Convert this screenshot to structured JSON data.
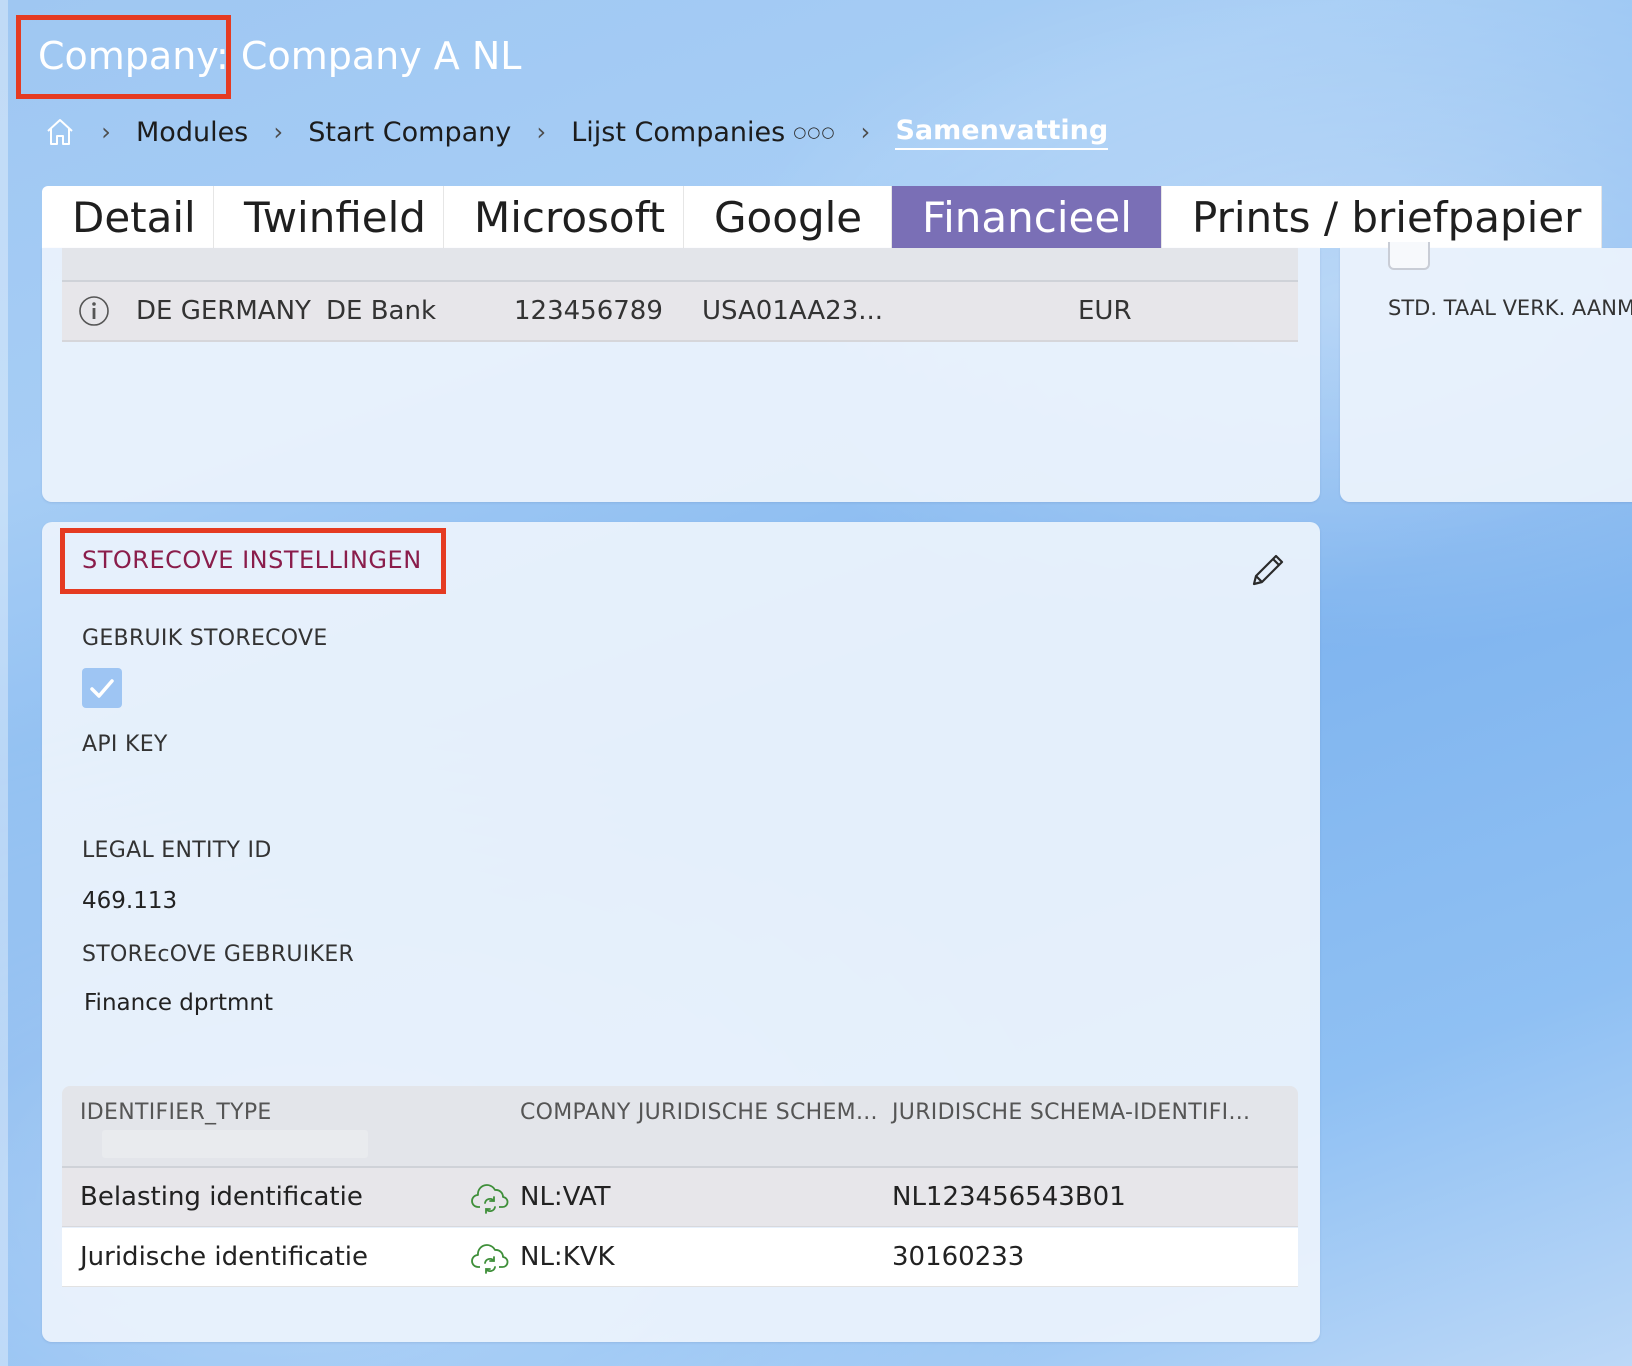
{
  "header": {
    "title_prefix": "Company:",
    "title_name": " Company A NL"
  },
  "breadcrumb": {
    "home_icon": "home-icon",
    "items": [
      "Modules",
      "Start Company",
      "Lijst Companies",
      "Samenvatting"
    ],
    "more_icon": "ellipsis-icon"
  },
  "tabs": [
    "Detail",
    "Twinfield",
    "Microsoft",
    "Google",
    "Financieel",
    "Prints / briefpapier"
  ],
  "active_tab": "Financieel",
  "bank_table": {
    "rows": [
      {
        "country": "DE GERMANY",
        "bank": "DE Bank",
        "number": "123456789",
        "iban": "USA01AA23...",
        "currency": "EUR"
      }
    ]
  },
  "right_panel": {
    "label": "STD. TAAL VERK. AANM"
  },
  "storecove": {
    "title": "STORECOVE INSTELLINGEN",
    "gebruik_label": "GEBRUIK STORECOVE",
    "gebruik_checked": true,
    "api_key_label": "API KEY",
    "api_key_value": "",
    "legal_entity_label": "LEGAL ENTITY ID",
    "legal_entity_value": "469.113",
    "gebruiker_label": "STOREcOVE GEBRUIKER",
    "gebruiker_value": "Finance dprtmnt"
  },
  "identifier_table": {
    "columns": [
      "IDENTIFIER_TYPE",
      "COMPANY JURIDISCHE SCHEM...",
      "JURIDISCHE SCHEMA-IDENTIFI..."
    ],
    "rows": [
      {
        "type": "Belasting identificatie",
        "scheme": "NL:VAT",
        "identifier": "NL123456543B01"
      },
      {
        "type": "Juridische identificatie",
        "scheme": "NL:KVK",
        "identifier": "30160233"
      }
    ]
  },
  "colors": {
    "active_tab": "#7a6fb6",
    "section_title": "#8a1d4b",
    "checkbox": "#9ec5f3",
    "cloud_icon": "#3f8f3a",
    "annotation": "#e53b22"
  }
}
